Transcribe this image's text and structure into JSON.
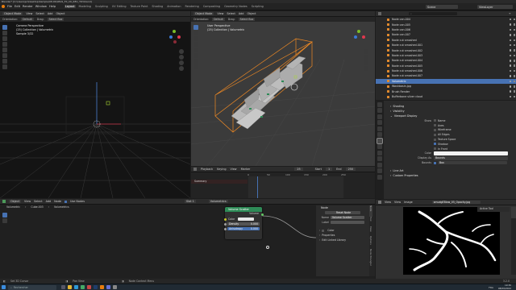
{
  "menubar": {
    "title": "Blender* [C:\\Users\\pc\\Desktop\\Sample\\08.09\\0819_FX_CK_REV_TOY.blend]"
  },
  "top": {
    "menus": [
      "File",
      "Edit",
      "Render",
      "Window",
      "Help"
    ],
    "workspaces": [
      "Layout",
      "Modeling",
      "Sculpting",
      "UV Editing",
      "Texture Paint",
      "Shading",
      "Animation",
      "Rendering",
      "Compositing",
      "Geometry Nodes",
      "Scripting"
    ],
    "active_workspace": "Layout",
    "scene": "Scene",
    "view_layer": "ViewLayer"
  },
  "left_viewport": {
    "mode": "Object Mode",
    "menus": [
      "View",
      "Select",
      "Add",
      "Object"
    ],
    "orientation_label": "Orientation:",
    "orientation": "Default",
    "drag_label": "Drag:",
    "select_box": "Select Box",
    "info_lines": [
      "Camera Perspective",
      "(25) Collection | Volumetric",
      "Sample 3/32"
    ]
  },
  "right_viewport": {
    "mode": "Object Mode",
    "menus": [
      "View",
      "Select",
      "Add",
      "Object"
    ],
    "orientation_label": "Orientation:",
    "orientation": "Default",
    "drag_label": "Drag:",
    "select_box": "Select Box",
    "info_lines": [
      "User Perspective",
      "(25) Collection | Volumetric"
    ]
  },
  "timeline": {
    "menus": [
      "Playback",
      "Keying",
      "View",
      "Marker"
    ],
    "start_label": "Start",
    "start": "1",
    "end_label": "End",
    "end": "250",
    "current": "25",
    "summary": "Summary",
    "ticks": [
      "0",
      "50",
      "100",
      "150",
      "200",
      "250"
    ]
  },
  "node_editor": {
    "header_items": [
      "Object",
      "View",
      "Select",
      "Add",
      "Node",
      "Use Nodes"
    ],
    "slot": "Slot 1",
    "material": "Volumetrics",
    "breadcrumb": [
      "Volumetric",
      "Cube.003",
      "Volumetrics"
    ],
    "scatter_node": {
      "title": "Volume Scatter",
      "output": "Volume",
      "color_label": "Color",
      "density_label": "Density",
      "density": "0.000",
      "anisotropy_label": "Anisotropy",
      "anisotropy": "0.000"
    },
    "npanel": {
      "section": "Node",
      "reset": "Reset Node",
      "name_label": "Name",
      "name": "Volume Scatter",
      "label_label": "Label",
      "color": "Color",
      "properties": "Properties",
      "texture_library": "Edit Linked Library"
    },
    "side_tabs": [
      "Node",
      "Tool",
      "View",
      "Options",
      "Node Wrangler"
    ]
  },
  "image_editor": {
    "menus": [
      "View",
      "View",
      "Image"
    ],
    "image_name": "smudgEBlow_05_Opacity.jpg",
    "active_tool": "Active Tool"
  },
  "outliner": {
    "search_placeholder": "",
    "items": [
      "Node can.004",
      "Node can.005",
      "Node can.006",
      "Node can.007",
      "Node cut smashed",
      "Node cut smashed.001",
      "Node cut smashed.002",
      "Node cut smashed.003",
      "Node cut smashed.004",
      "Node cut smashed.005",
      "Node cut smashed.006",
      "Node cut smashed.007",
      "Volumetric",
      "Washbasin.jpg",
      "Brush Render",
      "Bufferbone silver cloud"
    ],
    "selected_index": 12
  },
  "properties": {
    "sections": [
      "Shading",
      "Visibility",
      "Viewport Display"
    ],
    "show_label": "Show",
    "checks": [
      {
        "label": "Name",
        "on": false
      },
      {
        "label": "Axes",
        "on": false
      },
      {
        "label": "Wireframe",
        "on": false
      },
      {
        "label": "All Edges",
        "on": false
      },
      {
        "label": "Texture Space",
        "on": false
      },
      {
        "label": "Shadow",
        "on": true
      },
      {
        "label": "In Front",
        "on": false
      }
    ],
    "color_label": "Color",
    "display_as_label": "Display As",
    "display_as": "Bounds",
    "bounds_label": "Bounds",
    "bounds": "Box",
    "line_art": "Line Art",
    "custom_properties": "Custom Properties"
  },
  "status_bar": {
    "items": [
      "Set 3D Cursor",
      "Pan View",
      "Node Context Menu"
    ],
    "version": "3.2.0"
  },
  "taskbar": {
    "search_placeholder": "Rechercher",
    "clock": "19:30",
    "date": "08/09/2022",
    "tray_label": "FRA"
  },
  "colors": {
    "accent": "#4772b3",
    "object_orange": "#e28a2e",
    "node_green": "#2e8b57",
    "playhead": "#4772b3",
    "bbox_orange": "#f08a24"
  }
}
